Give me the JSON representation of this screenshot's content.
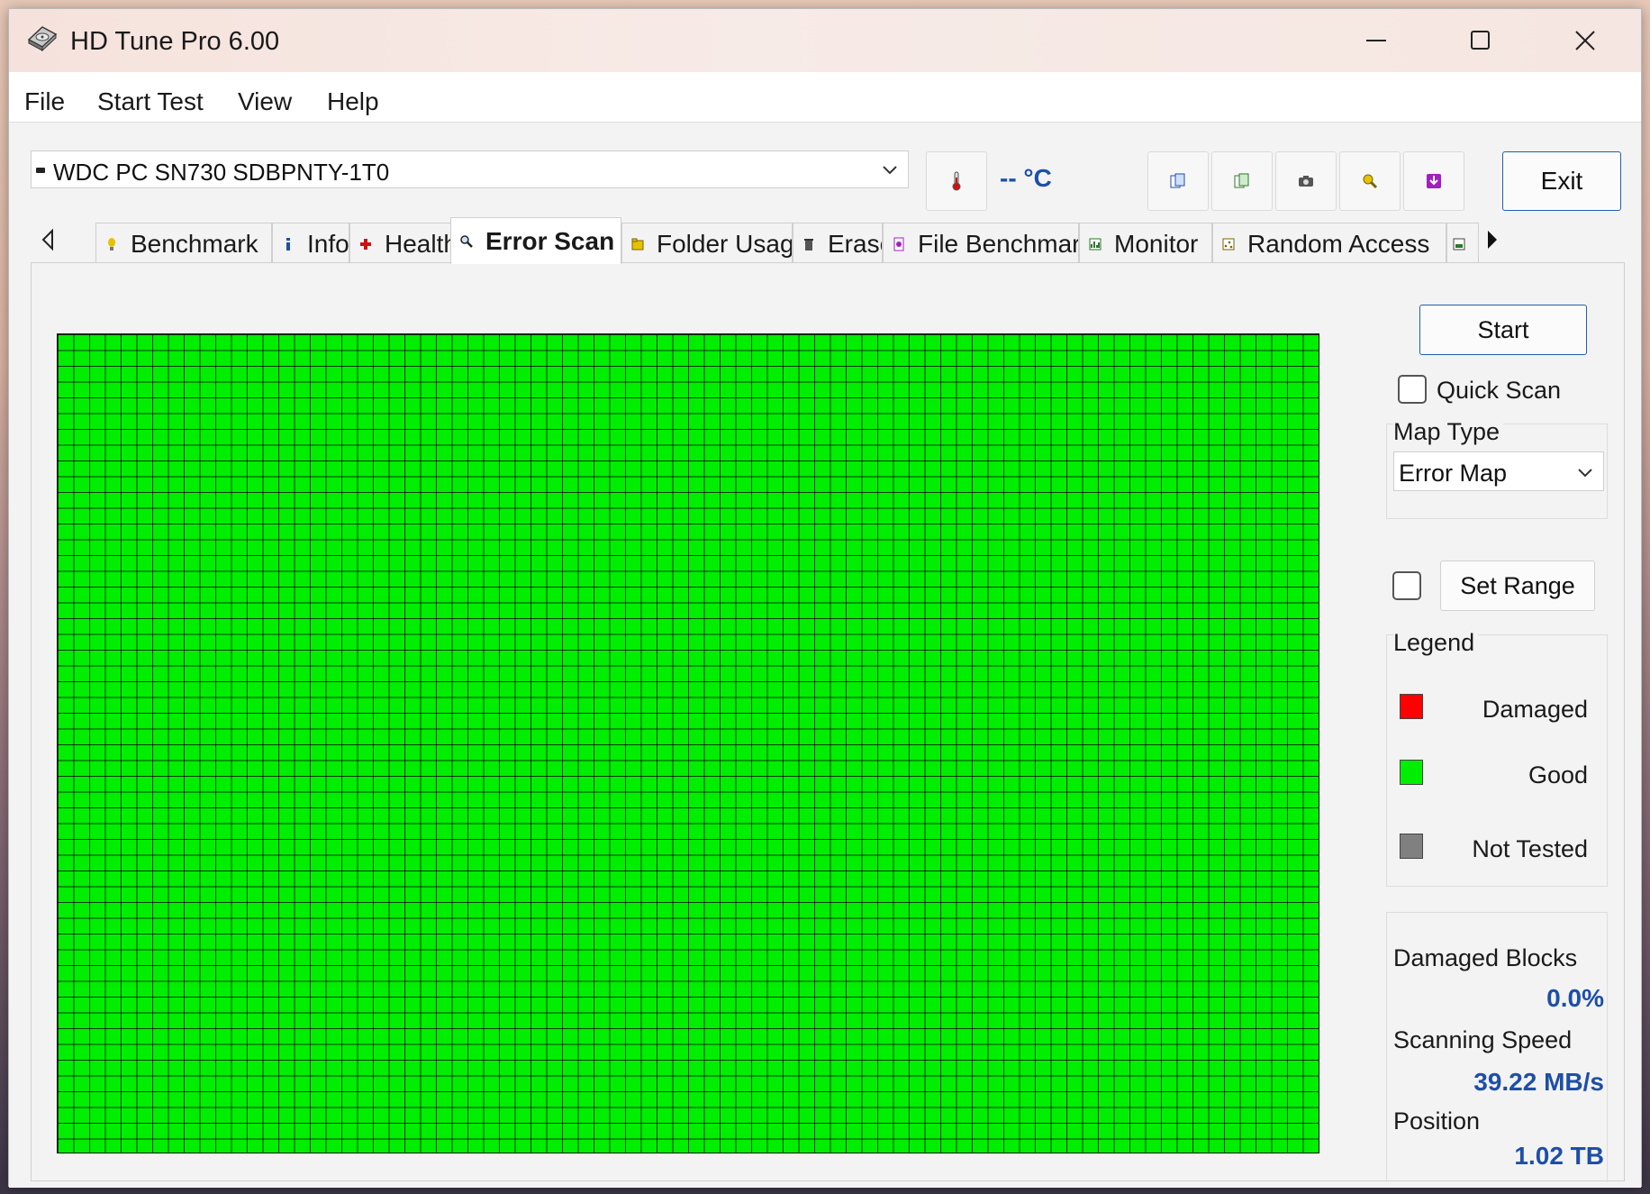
{
  "window": {
    "title": "HD Tune Pro 6.00"
  },
  "menu": [
    "File",
    "Start Test",
    "View",
    "Help"
  ],
  "toolbar": {
    "drive": "WDC PC SN730 SDBPNTY-1T0",
    "temperature": "-- °C",
    "exit_label": "Exit",
    "tool_icons": [
      "copy-info-icon",
      "copy-all-icon",
      "screenshot-icon",
      "options-icon",
      "save-icon"
    ]
  },
  "tabs": [
    "Benchmark",
    "Info",
    "Health",
    "Error Scan",
    "Folder Usage",
    "Erase",
    "File Benchmark",
    "Monitor",
    "Random Access"
  ],
  "active_tab": "Error Scan",
  "error_scan": {
    "start_label": "Start",
    "quick_scan_label": "Quick Scan",
    "quick_scan_checked": false,
    "map_type_label": "Map Type",
    "map_type_value": "Error Map",
    "set_range_checked": false,
    "set_range_label": "Set Range",
    "legend_title": "Legend",
    "legend": [
      {
        "label": "Damaged",
        "color": "#ff0000"
      },
      {
        "label": "Good",
        "color": "#00ee00"
      },
      {
        "label": "Not Tested",
        "color": "#808080"
      }
    ],
    "damaged_blocks_label": "Damaged Blocks",
    "damaged_blocks_value": "0.0%",
    "scanning_speed_label": "Scanning Speed",
    "scanning_speed_value": "39.22 MB/s",
    "position_label": "Position",
    "position_value": "1.02 TB",
    "map_block_color": "#00ee00"
  }
}
